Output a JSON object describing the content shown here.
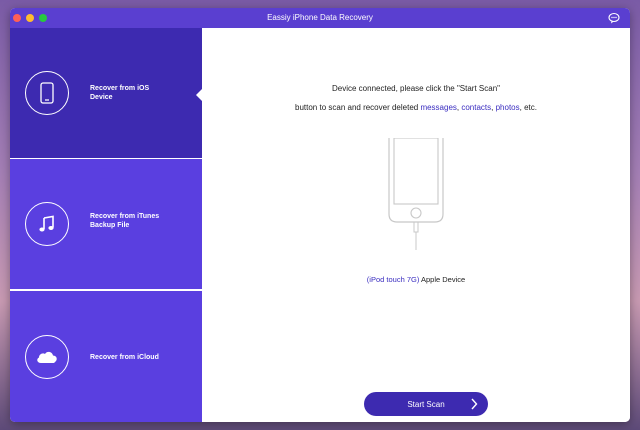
{
  "window": {
    "title": "Eassiy iPhone Data Recovery"
  },
  "sidebar": {
    "items": [
      {
        "label_line1": "Recover from iOS",
        "label_line2": "Device",
        "icon": "iphone-icon",
        "active": true
      },
      {
        "label_line1": "Recover from iTunes",
        "label_line2": "Backup File",
        "icon": "music-note-icon",
        "active": false
      },
      {
        "label_line1": "Recover from iCloud",
        "label_line2": "",
        "icon": "cloud-icon",
        "active": false
      }
    ]
  },
  "main": {
    "message_line1": "Device connected, please click the \"Start Scan\"",
    "message_line2_prefix": "button to scan and recover deleted ",
    "message_link_messages": "messages",
    "message_sep1": ", ",
    "message_link_contacts": "contacts",
    "message_sep2": ", ",
    "message_link_photos": "photos",
    "message_suffix": ", etc.",
    "device_model": "(iPod touch 7G)",
    "device_name": " Apple Device",
    "scan_button_label": "Start Scan"
  },
  "colors": {
    "sidebar_active": "#3d2ab0",
    "sidebar_inactive": "#5a3fe0",
    "titlebar": "#5a3fd0",
    "link": "#3a2dc0"
  }
}
